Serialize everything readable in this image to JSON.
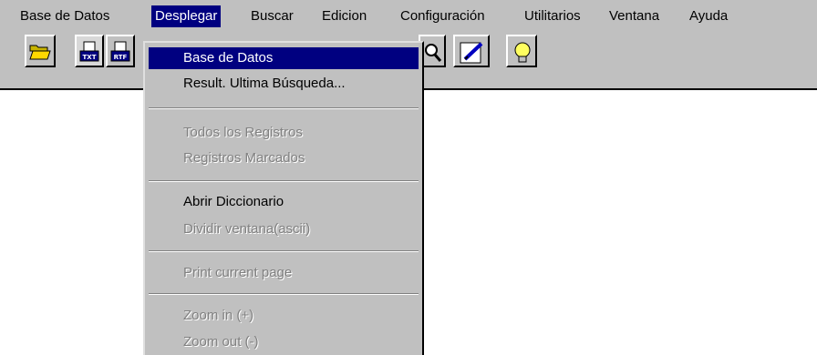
{
  "menubar": {
    "items": [
      {
        "label": "Base de Datos"
      },
      {
        "label": "Desplegar",
        "active": true
      },
      {
        "label": "Buscar"
      },
      {
        "label": "Edicion"
      },
      {
        "label": "Configuración"
      },
      {
        "label": "Utilitarios"
      },
      {
        "label": "Ventana"
      },
      {
        "label": "Ayuda"
      }
    ]
  },
  "toolbar": {
    "buttons": [
      {
        "icon": "open-folder-icon"
      },
      {
        "icon": "txt-document-icon",
        "text": "TXT"
      },
      {
        "icon": "rtf-document-icon",
        "text": "RTF"
      },
      {
        "icon": "magnifier-icon"
      },
      {
        "icon": "edit-pencil-icon"
      },
      {
        "icon": "lightbulb-icon"
      }
    ]
  },
  "dropdown": {
    "items": [
      {
        "label": "Base de Datos",
        "state": "selected"
      },
      {
        "label": "Result. Ultima Búsqueda...",
        "state": "enabled"
      },
      {
        "label": "Todos los Registros",
        "state": "disabled"
      },
      {
        "label": "Registros Marcados",
        "state": "disabled"
      },
      {
        "label": "Abrir Diccionario",
        "state": "enabled"
      },
      {
        "label": "Dividir ventana(ascii)",
        "state": "disabled"
      },
      {
        "label": "Print current page",
        "state": "disabled"
      },
      {
        "label": "Zoom in (+)",
        "state": "disabled"
      },
      {
        "label": "Zoom out (-)",
        "state": "disabled"
      }
    ]
  },
  "colors": {
    "face": "#c0c0c0",
    "highlight": "#000080",
    "disabled_text": "#808080"
  }
}
